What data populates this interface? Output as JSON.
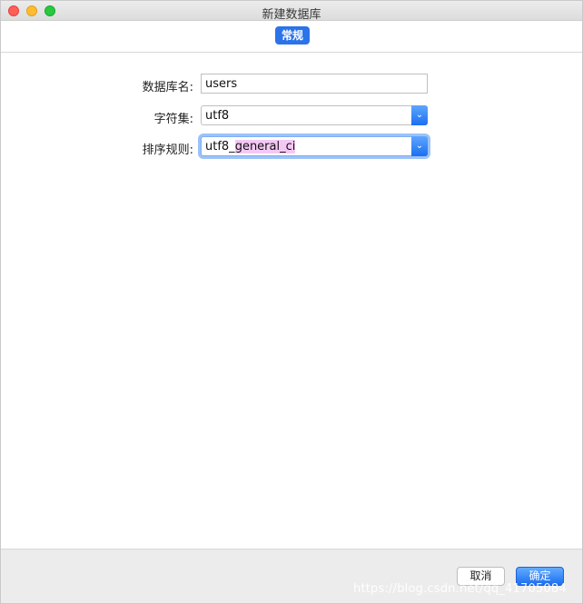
{
  "window": {
    "title": "新建数据库"
  },
  "tabs": [
    {
      "label": "常规",
      "active": true
    }
  ],
  "form": {
    "name_label": "数据库名:",
    "name_value": "users",
    "charset_label": "字符集:",
    "charset_value": "utf8",
    "collation_label": "排序规则:",
    "collation_prefix": "utf8_",
    "collation_highlight": "general_ci"
  },
  "footer": {
    "cancel_label": "取消",
    "ok_label": "确定",
    "watermark": "https://blog.csdn.net/qq_41705084"
  },
  "colors": {
    "accent": "#2b73e8",
    "close": "#fe5f57",
    "minimize": "#febc2e",
    "maximize": "#28c840"
  }
}
